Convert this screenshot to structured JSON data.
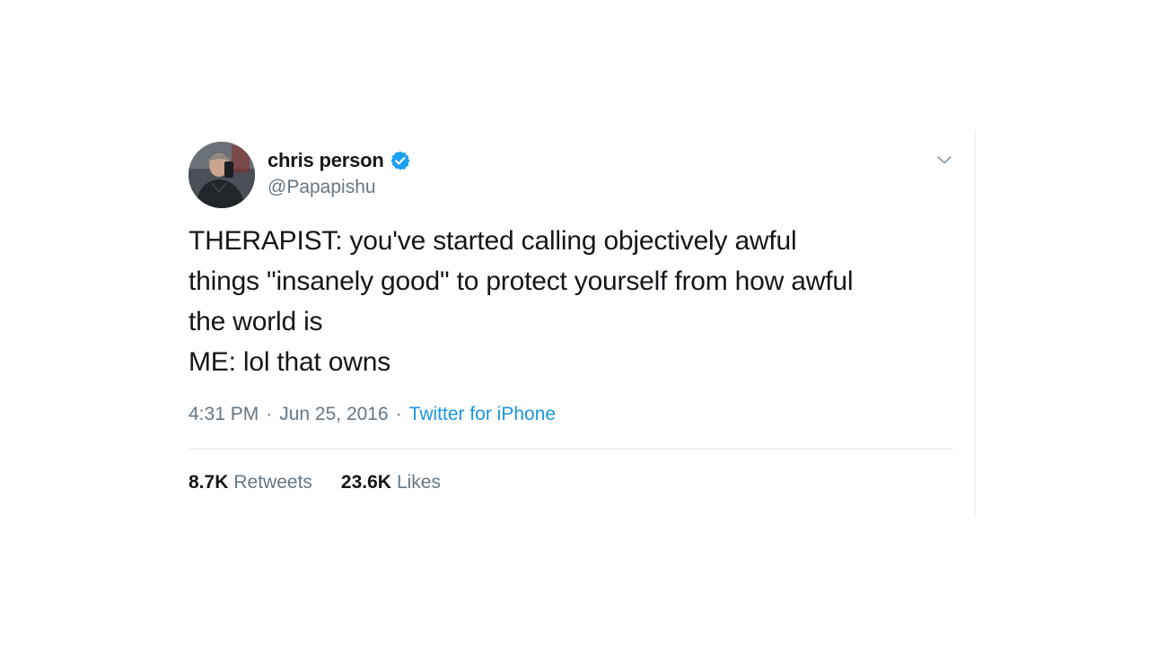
{
  "tweet": {
    "author": {
      "name": "chris person",
      "handle": "@Papapishu",
      "verified": true,
      "avatar_icon": "profile-photo"
    },
    "text": "THERAPIST: you've started calling objectively awful\nthings \"insanely good\" to protect yourself from how awful\nthe world is\nME: lol that owns",
    "time": "4:31 PM",
    "separator": "·",
    "date": "Jun 25, 2016",
    "source": "Twitter for iPhone",
    "stats": {
      "retweets_count": "8.7K",
      "retweets_label": "Retweets",
      "likes_count": "23.6K",
      "likes_label": "Likes"
    }
  },
  "colors": {
    "text_primary": "#14171a",
    "text_secondary": "#657786",
    "link": "#1b95e0",
    "verified": "#1da1f2",
    "divider": "#e1e8ed"
  },
  "icons": {
    "verified": "verified-badge-icon",
    "menu": "chevron-down-icon"
  }
}
